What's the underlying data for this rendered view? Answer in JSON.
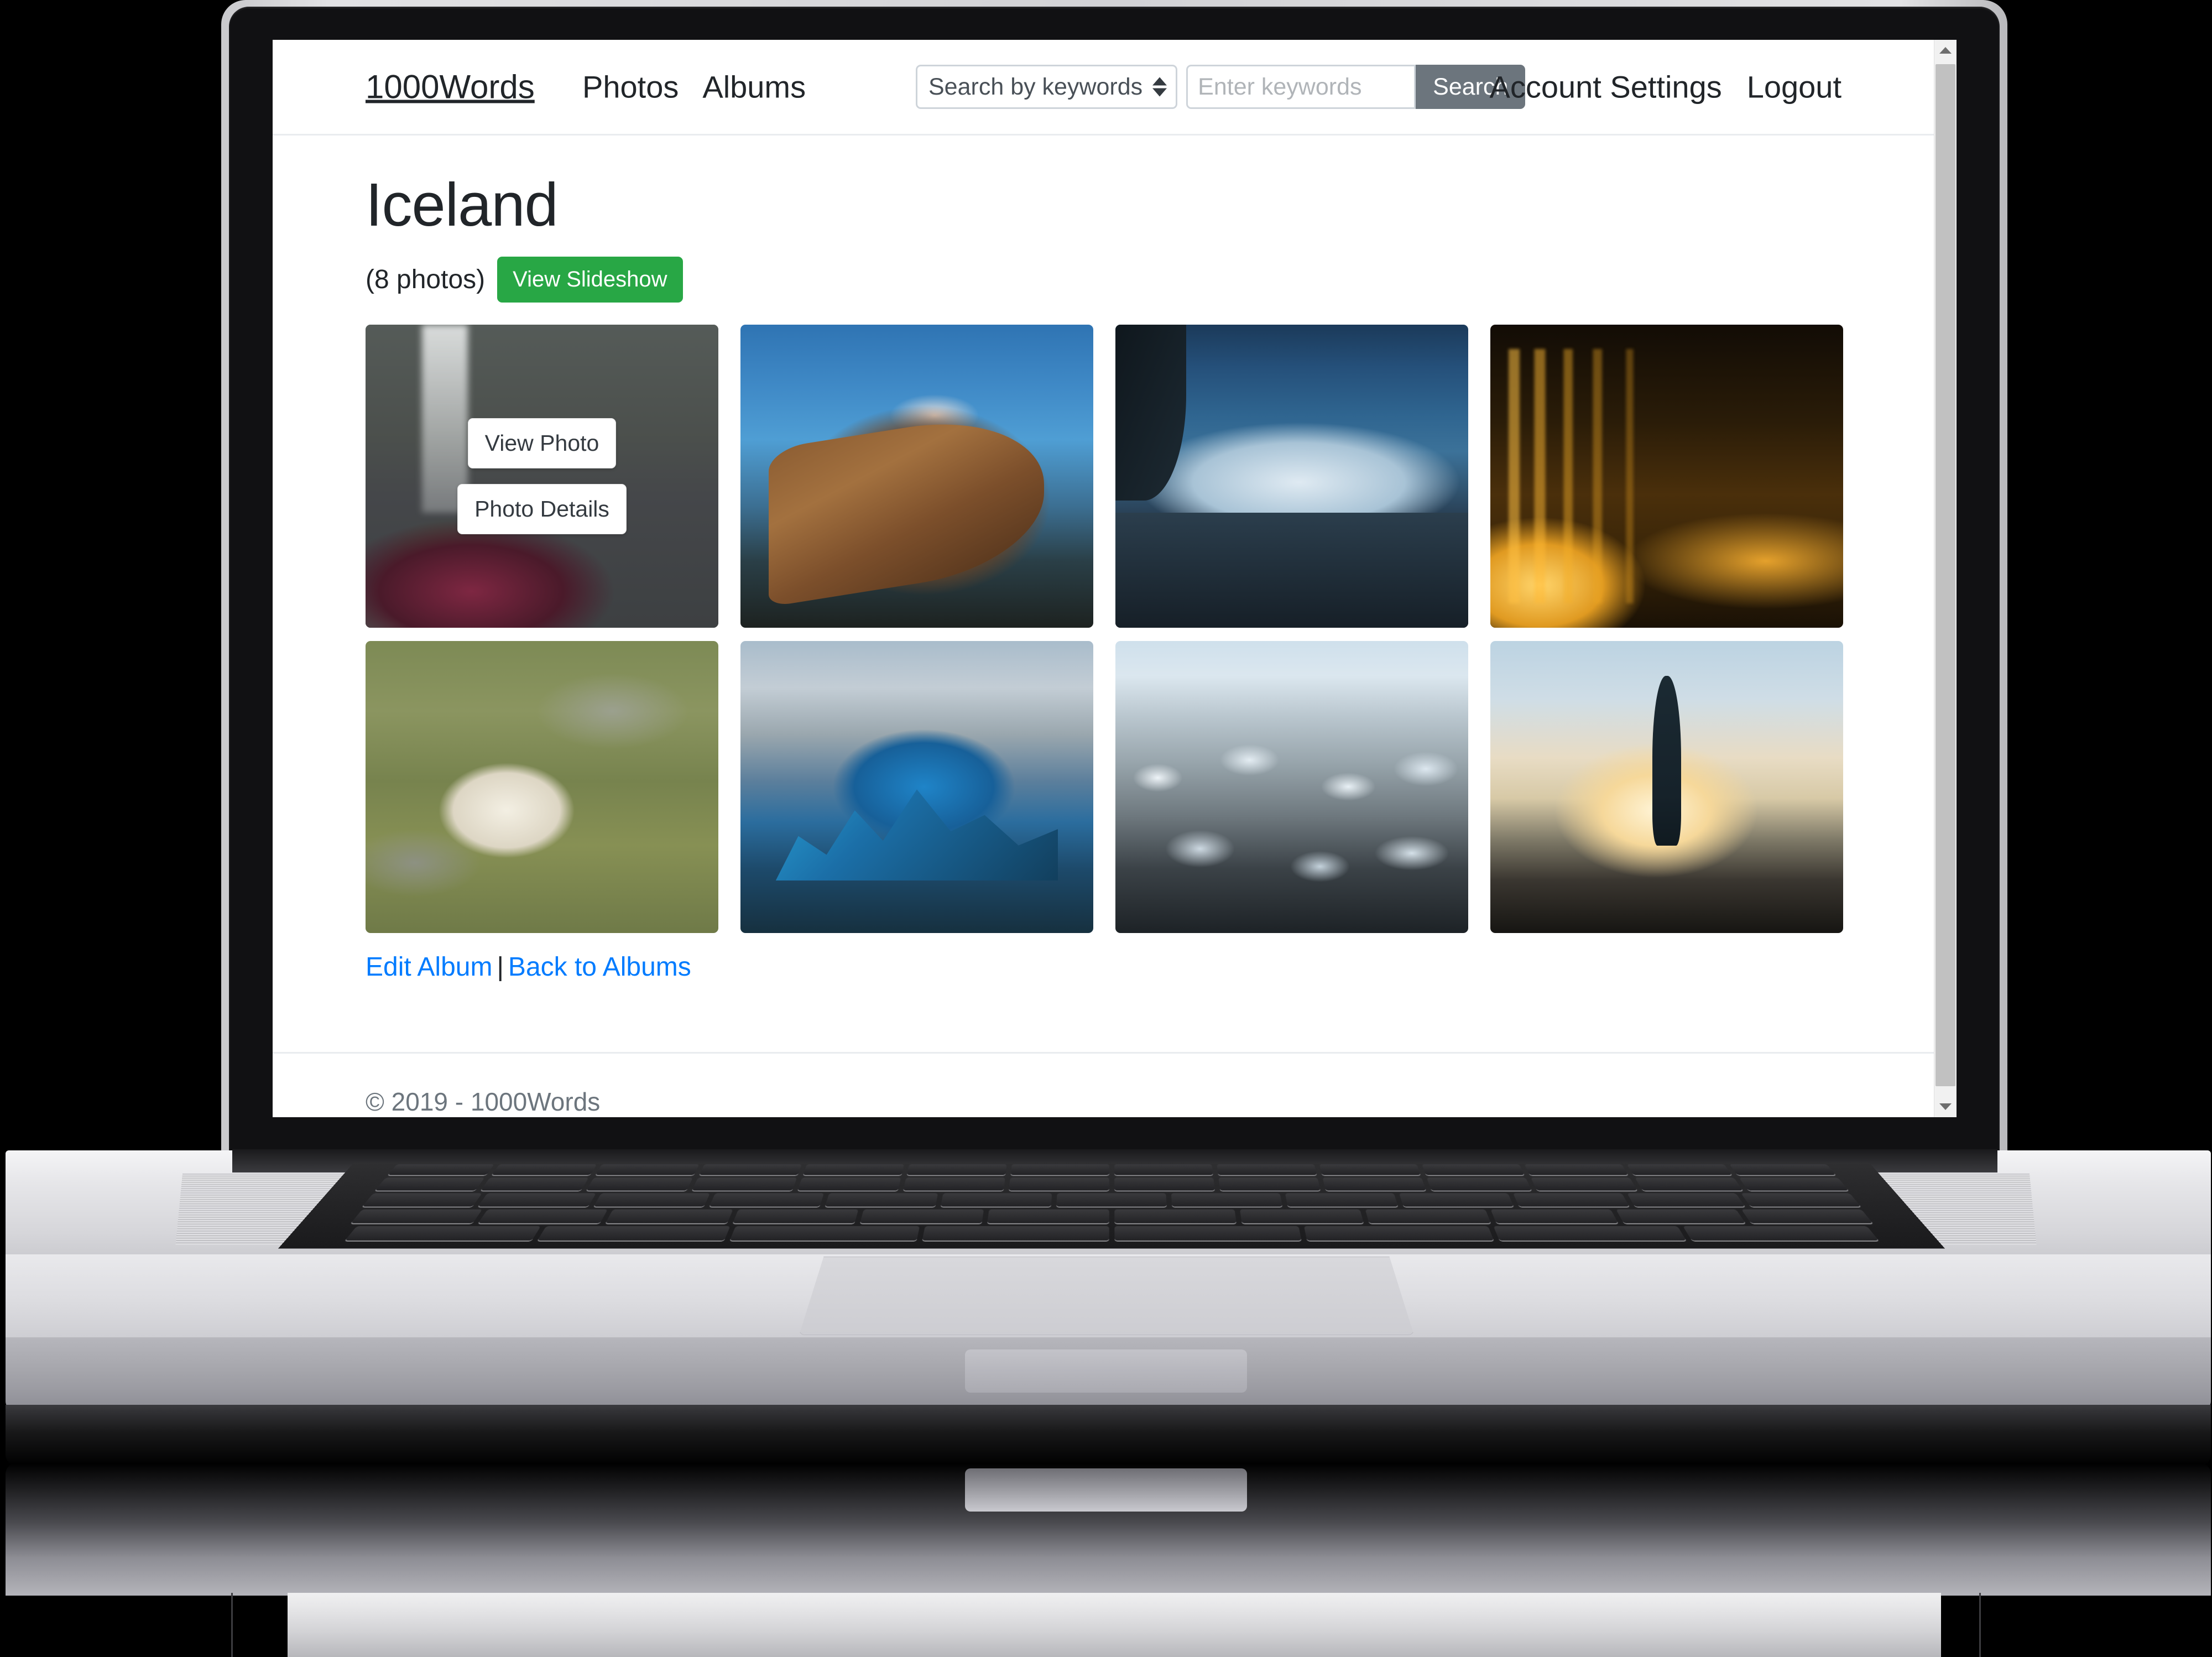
{
  "nav": {
    "brand": "1000Words",
    "links": [
      {
        "label": "Photos",
        "name": "nav-photos"
      },
      {
        "label": "Albums",
        "name": "nav-albums"
      }
    ],
    "search": {
      "selected_option": "Search by keywords",
      "options": [
        "Search by keywords"
      ],
      "input_value": "",
      "placeholder": "Enter keywords",
      "button_label": "Search"
    },
    "right_links": [
      {
        "label": "Account Settings",
        "name": "nav-account-settings"
      },
      {
        "label": "Logout",
        "name": "nav-logout"
      }
    ]
  },
  "album": {
    "title": "Iceland",
    "photo_count_label": "(8 photos)",
    "slideshow_button": "View Slideshow",
    "overlay": {
      "view_photo": "View Photo",
      "photo_details": "Photo Details"
    },
    "edit_link": "Edit Album",
    "separator": "|",
    "back_link": "Back to Albums",
    "photos": [
      {
        "alt": "Couple selfie in front of Skogafoss waterfall",
        "style": "ph-waterfall",
        "has_overlay": true
      },
      {
        "alt": "Old wooden shipwreck boat at dusk",
        "style": "ph-boat",
        "has_overlay": false
      },
      {
        "alt": "Gullfoss waterfall at blue hour",
        "style": "ph-falls",
        "has_overlay": false
      },
      {
        "alt": "Golden birch trees lit at night",
        "style": "ph-trees",
        "has_overlay": false
      },
      {
        "alt": "Icelandic sheep on mossy rocks",
        "style": "ph-sheep",
        "has_overlay": false
      },
      {
        "alt": "Blue icebergs in glacier lagoon",
        "style": "ph-iceberg",
        "has_overlay": false
      },
      {
        "alt": "Ice chunks on black sand beach",
        "style": "ph-ice",
        "has_overlay": false
      },
      {
        "alt": "Person silhouetted at sunset on Diamond Beach",
        "style": "ph-sunset",
        "has_overlay": false
      }
    ]
  },
  "footer": {
    "copyright": "© 2019 - 1000Words"
  },
  "colors": {
    "accent_green": "#28a745",
    "link_blue": "#007bff",
    "search_button_gray": "#6c757d",
    "muted_text": "#6c757d",
    "border_light": "#e9ecef"
  }
}
